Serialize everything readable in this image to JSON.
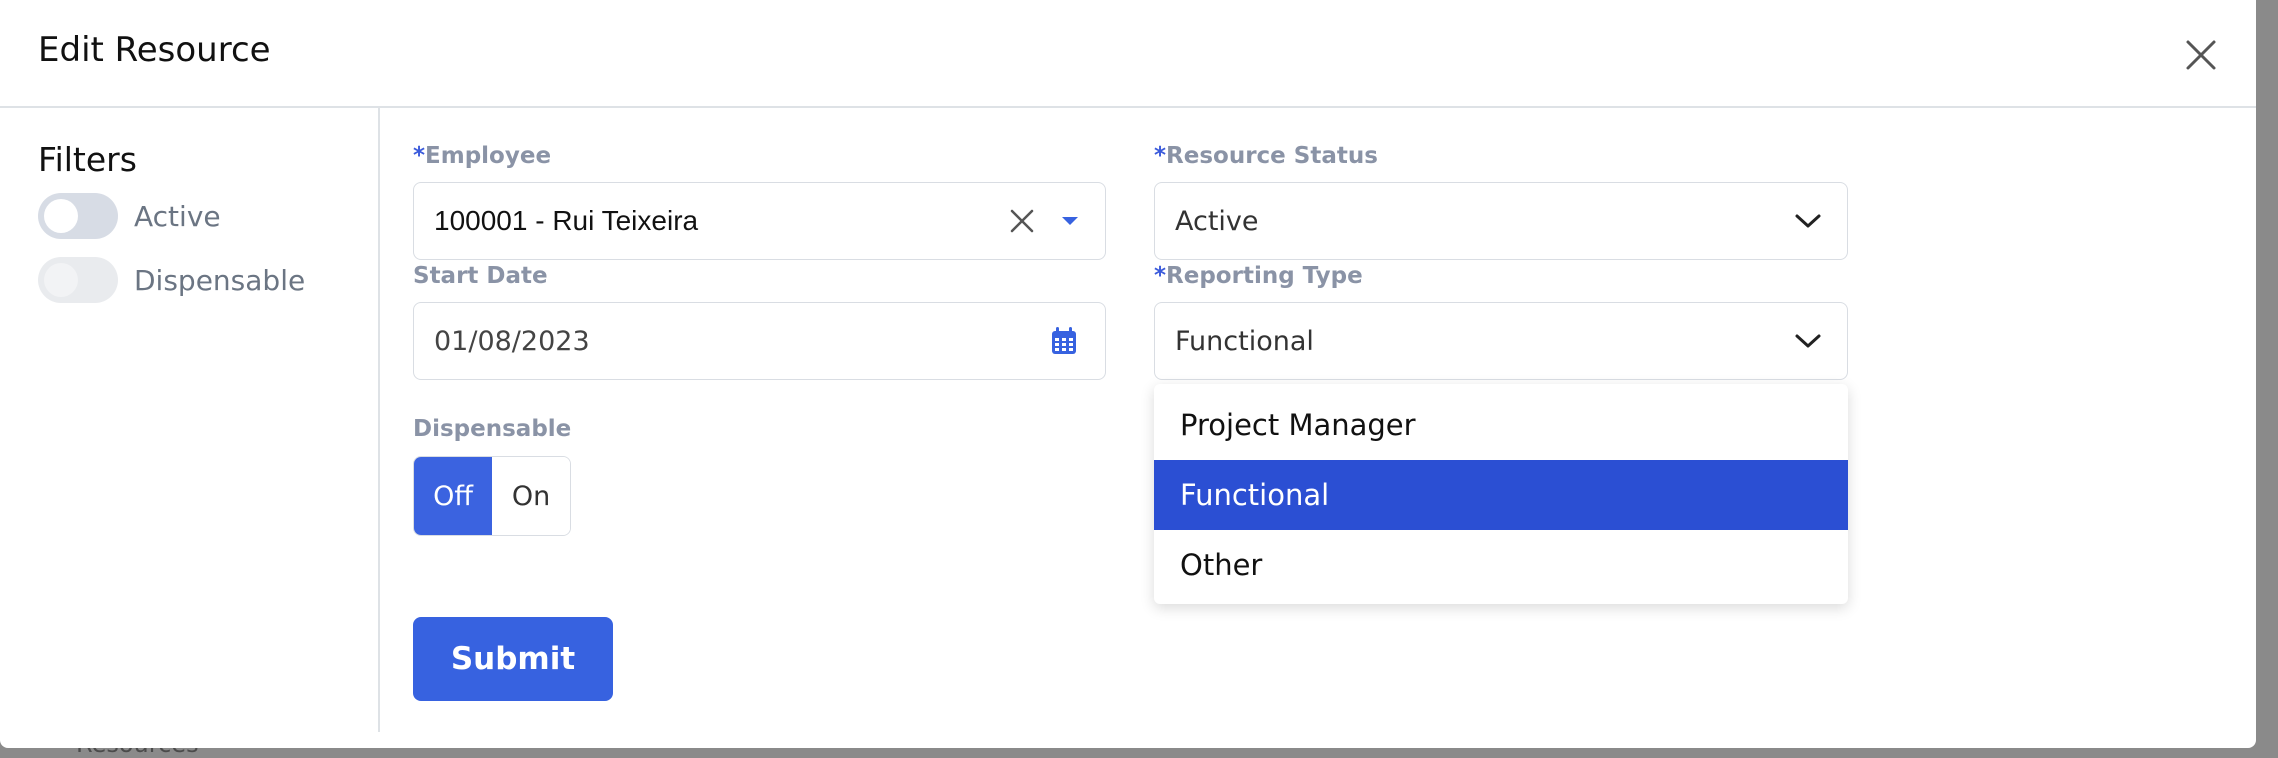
{
  "backdrop": {
    "text": "Resources"
  },
  "modal": {
    "title": "Edit Resource"
  },
  "sidebar": {
    "title": "Filters",
    "toggles": [
      {
        "label": "Active",
        "enabled": true
      },
      {
        "label": "Dispensable",
        "enabled": false
      }
    ]
  },
  "form": {
    "employee": {
      "label": "Employee",
      "required_mark": "*",
      "value": "100001 - Rui Teixeira"
    },
    "resource_status": {
      "label": "Resource Status",
      "required_mark": "*",
      "value": "Active"
    },
    "start_date": {
      "label": "Start Date",
      "value": "01/08/2023"
    },
    "reporting_type": {
      "label": "Reporting Type",
      "required_mark": "*",
      "value": "Functional",
      "options": [
        "Project Manager",
        "Functional",
        "Other"
      ],
      "selected_index": 1
    },
    "dispensable": {
      "label": "Dispensable",
      "off_label": "Off",
      "on_label": "On",
      "selected": "Off"
    },
    "submit_label": "Submit"
  },
  "colors": {
    "accent": "#3762e0",
    "selected_option": "#2b4fd3",
    "label": "#8a93a6"
  },
  "icons": {
    "close": "close-icon",
    "clear": "clear-icon",
    "caret": "caret-down-icon",
    "chevron": "chevron-down-icon",
    "calendar": "calendar-icon"
  }
}
